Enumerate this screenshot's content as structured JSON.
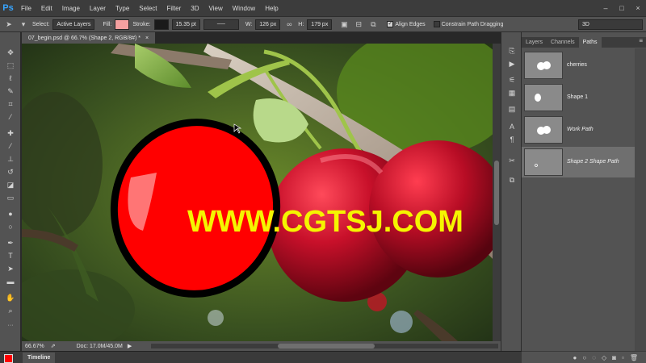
{
  "app": {
    "logo": "Ps",
    "menu": [
      "File",
      "Edit",
      "Image",
      "Layer",
      "Type",
      "Select",
      "Filter",
      "3D",
      "View",
      "Window",
      "Help"
    ],
    "window_controls": [
      "–",
      "□",
      "×"
    ]
  },
  "options_bar": {
    "select_label": "Select:",
    "select_value": "Active Layers",
    "fill_label": "Fill:",
    "fill_color": "#f4a0a0",
    "stroke_label": "Stroke:",
    "stroke_width": "15.35 pt",
    "w_label": "W:",
    "w_value": "126 px",
    "h_label": "H:",
    "h_value": "179 px",
    "align_edges_label": "Align Edges",
    "align_edges_checked": true,
    "constrain_label": "Constrain Path Dragging",
    "constrain_checked": false,
    "workspace": "3D"
  },
  "document": {
    "tab_label": "07_begin.psd @ 66.7% (Shape 2, RGB/8#) *",
    "zoom": "66.67%",
    "doc_info": "Doc: 17.0M/45.0M"
  },
  "colors": {
    "foreground": "#ff0000",
    "background": "#ffffff",
    "shape_fill": "#ff0000",
    "accent": "#38a5ff"
  },
  "timeline": {
    "tab_label": "Timeline"
  },
  "paths_panel": {
    "tabs": [
      {
        "label": "Layers",
        "active": false
      },
      {
        "label": "Channels",
        "active": false
      },
      {
        "label": "Paths",
        "active": true
      }
    ],
    "paths": [
      {
        "name": "cherries",
        "italic": false,
        "selected": false
      },
      {
        "name": "Shape 1",
        "italic": false,
        "selected": false
      },
      {
        "name": "Work Path",
        "italic": true,
        "selected": false
      },
      {
        "name": "Shape 2 Shape Path",
        "italic": true,
        "selected": true
      }
    ]
  },
  "watermark": "WWW.CGTSJ.COM",
  "icons": {
    "tools": [
      "move-icon",
      "marquee-icon",
      "lasso-icon",
      "quick-select-icon",
      "crop-icon",
      "eyedropper-icon",
      "healing-icon",
      "brush-icon",
      "stamp-icon",
      "history-brush-icon",
      "eraser-icon",
      "gradient-icon",
      "blur-icon",
      "dodge-icon",
      "pen-icon",
      "type-icon",
      "path-select-icon",
      "shape-icon",
      "hand-icon",
      "zoom-icon"
    ],
    "strip": [
      "history-icon",
      "actions-icon",
      "adjust-icon",
      "styles-icon",
      "character-icon",
      "paragraph-icon",
      "tool-presets-icon",
      "layer-comps-icon"
    ],
    "footer": [
      "fill-path-icon",
      "stroke-path-icon",
      "load-selection-icon",
      "make-work-path-icon",
      "add-mask-icon",
      "new-path-icon",
      "delete-path-icon"
    ]
  }
}
